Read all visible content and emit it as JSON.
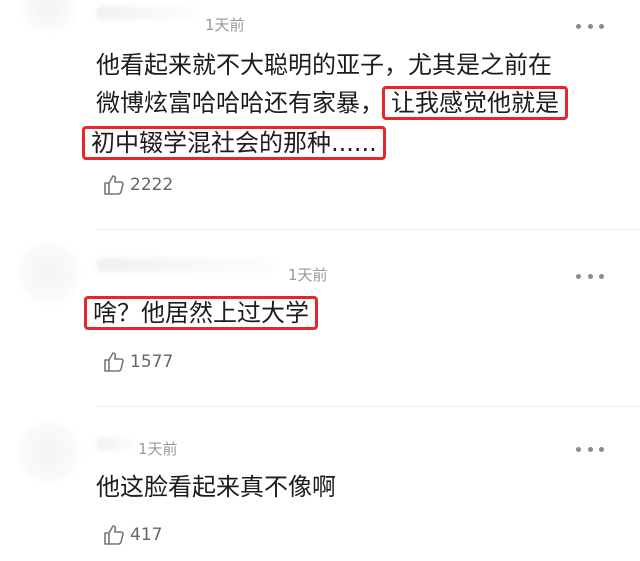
{
  "comments": [
    {
      "time": "1天前",
      "line1": "他看起来就不大聪明的亚子，尤其是之前在",
      "line2_plain": "微博炫富哈哈哈还有家暴，",
      "line2_highlight": "让我感觉他就是",
      "line3_highlight": "初中辍学混社会的那种......",
      "likes": "2222"
    },
    {
      "time": "1天前",
      "text_highlight": "啥？他居然上过大学",
      "likes": "1577"
    },
    {
      "time": "1天前",
      "text": "他这脸看起来真不像啊",
      "likes": "417"
    }
  ],
  "colors": {
    "highlight_border": "#e5262a",
    "time_text": "#9a9a9a",
    "like_text": "#666666"
  }
}
